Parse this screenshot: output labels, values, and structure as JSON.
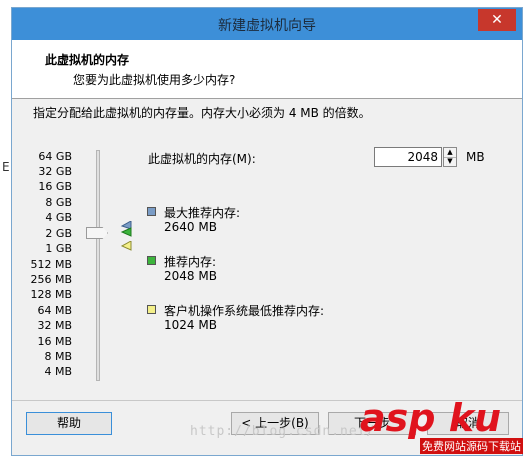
{
  "background": {
    "stray_char": "E"
  },
  "window": {
    "title": "新建虚拟机向导",
    "close_label": "✕"
  },
  "header": {
    "title": "此虚拟机的内存",
    "subtitle": "您要为此虚拟机使用多少内存?"
  },
  "description": "指定分配给此虚拟机的内存量。内存大小必须为 4 MB 的倍数。",
  "scale": {
    "labels": [
      "64 GB",
      "32 GB",
      "16 GB",
      "8 GB",
      "4 GB",
      "2 GB",
      "1 GB",
      "512 MB",
      "256 MB",
      "128 MB",
      "64 MB",
      "32 MB",
      "16 MB",
      "8 MB",
      "4 MB"
    ]
  },
  "memory": {
    "label": "此虚拟机的内存(M):",
    "value": "2048",
    "unit": "MB"
  },
  "legend": {
    "max": {
      "title": "最大推荐内存:",
      "value": "2640 MB",
      "color": "#7a9cc6"
    },
    "recommended": {
      "title": "推荐内存:",
      "value": "2048 MB",
      "color": "#3cb43c"
    },
    "guest_min": {
      "title": "客户机操作系统最低推荐内存:",
      "value": "1024 MB",
      "color": "#f4f08a"
    }
  },
  "buttons": {
    "help": "帮助",
    "back": "< 上一步(B)",
    "next": "下一步",
    "cancel": "取消"
  },
  "watermark": {
    "url": "http://blog.csdn.net/",
    "logo": "asp ku",
    "tag": "免费网站源码下载站"
  }
}
